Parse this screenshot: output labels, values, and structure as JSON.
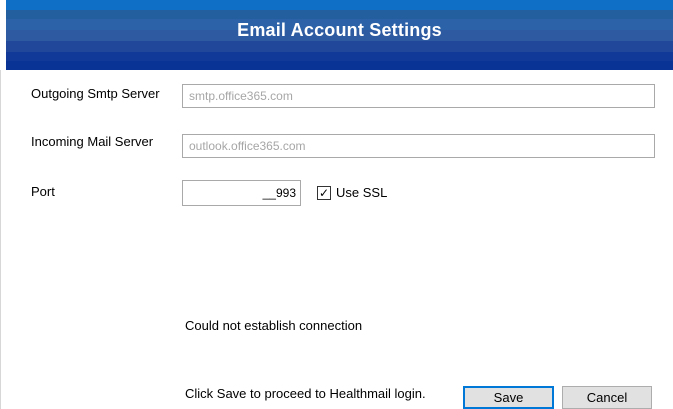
{
  "dialog": {
    "title": "Email Account Settings"
  },
  "form": {
    "smtp_label": "Outgoing Smtp Server",
    "smtp_value": "smtp.office365.com",
    "imap_label": "Incoming Mail Server",
    "imap_value": "outlook.office365.com",
    "port_label": "Port",
    "port_value": "__993",
    "ssl_label": "Use SSL",
    "ssl_checked": true
  },
  "status": {
    "message": "Could not establish connection",
    "hint": "Click Save to proceed to Healthmail login."
  },
  "buttons": {
    "save_label": "Save",
    "cancel_label": "Cancel"
  },
  "colors": {
    "header_blue": "#103998",
    "accent": "#0078d7"
  }
}
